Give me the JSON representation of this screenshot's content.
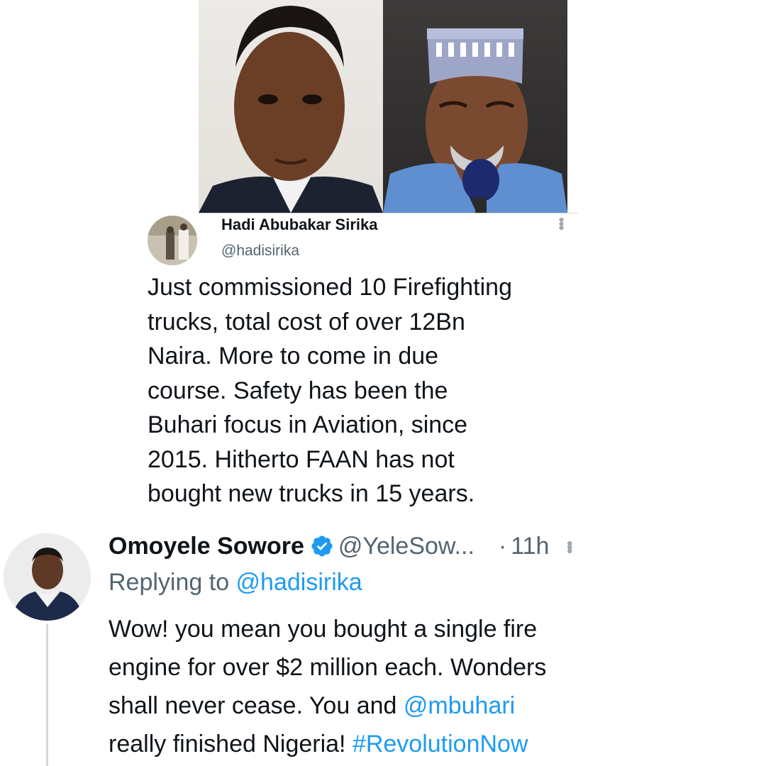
{
  "photos": {
    "left_icon": "man-portrait-photo",
    "right_icon": "man-with-cap-and-microphone-photo"
  },
  "quoted_tweet": {
    "name": "Hadi Abubakar Sirika",
    "handle": "@hadisirika",
    "more_icon": "more-vertical-icon",
    "lines": [
      "Just commissioned 10 Firefighting",
      "trucks, total cost of over 12Bn",
      "Naira. More to come in due",
      "course. Safety has been the",
      "Buhari focus in Aviation, since",
      "2015. Hitherto FAAN has not",
      "bought new trucks in 15 years."
    ]
  },
  "reply_tweet": {
    "name": "Omoyele Sowore",
    "handle": "@YeleSow...",
    "dot": "·",
    "time": "11h",
    "replying_prefix": "Replying to ",
    "replying_mention": "@hadisirika",
    "line1": "Wow! you mean you bought a single fire",
    "line2": "engine for over $2 million each. Wonders",
    "line3_a": "shall never cease. You and ",
    "line3_mention": "@mbuhari",
    "line4_a": "really finished Nigeria! ",
    "line4_hashtag": "#RevolutionNow"
  },
  "colors": {
    "text": "#0f1419",
    "secondary": "#536471",
    "link": "#1d9bf0",
    "verified": "#1d9bf0"
  }
}
